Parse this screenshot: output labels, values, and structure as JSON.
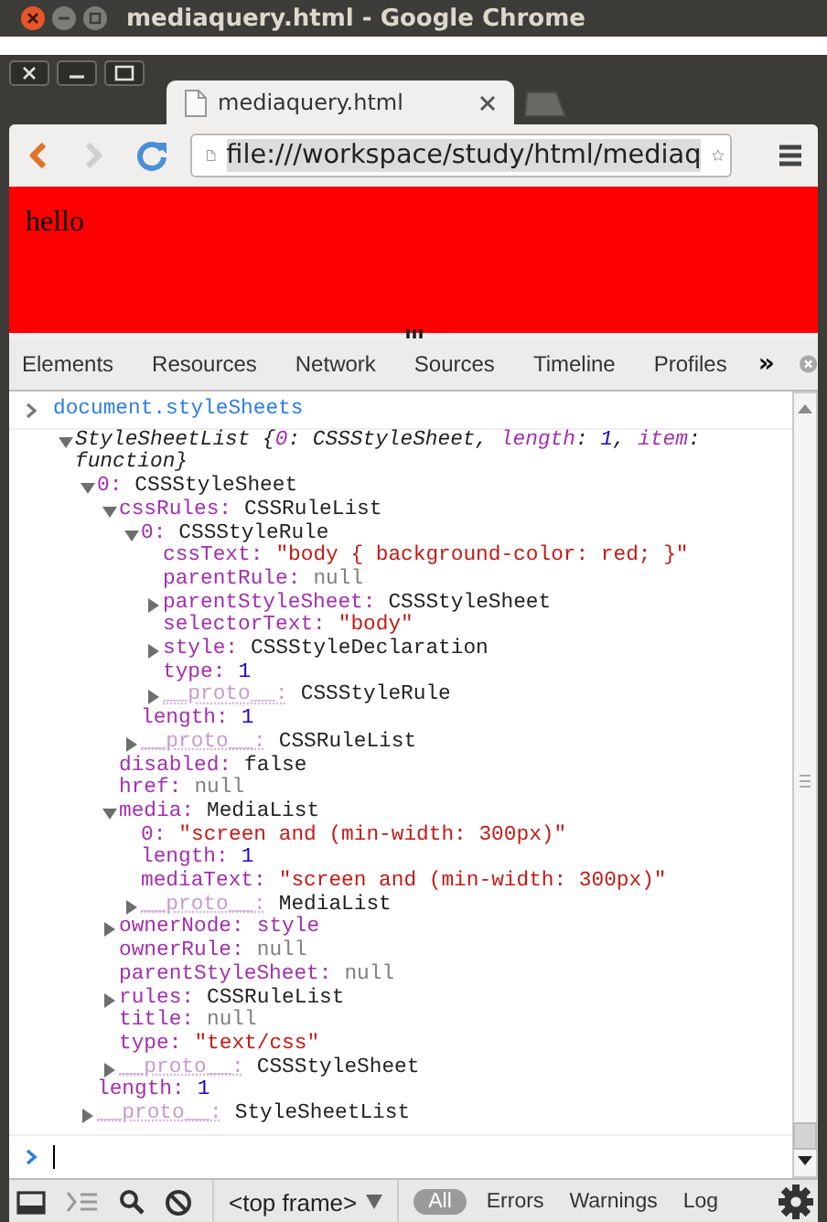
{
  "os_window": {
    "title": "mediaquery.html - Google Chrome"
  },
  "browser": {
    "tab": {
      "title": "mediaquery.html"
    },
    "address": {
      "url": "file:///workspace/study/html/mediaq",
      "selected": true
    },
    "back_disabled": false,
    "forward_disabled": true
  },
  "page": {
    "text": "hello"
  },
  "devtools": {
    "tabs": [
      "Elements",
      "Resources",
      "Network",
      "Sources",
      "Timeline",
      "Profiles"
    ],
    "overflow": "»",
    "console": {
      "command": "document.styleSheets",
      "result": {
        "summary": [
          {
            "text": "StyleSheetList {",
            "kind": "plain"
          },
          {
            "text": "0",
            "kind": "key"
          },
          {
            "text": ": CSSStyleSheet, ",
            "kind": "plain"
          },
          {
            "text": "length",
            "kind": "key"
          },
          {
            "text": ": ",
            "kind": "plain"
          },
          {
            "text": "1",
            "kind": "number"
          },
          {
            "text": ", ",
            "kind": "plain"
          },
          {
            "text": "item",
            "kind": "key"
          },
          {
            "text": ": function}",
            "kind": "plain"
          }
        ],
        "expanded": true,
        "children": [
          {
            "kind": "object",
            "key": "0:",
            "internal": false,
            "value": {
              "text": "CSSStyleSheet",
              "kind": "object"
            },
            "expanded": true,
            "children": [
              {
                "kind": "object",
                "key": "cssRules:",
                "internal": false,
                "value": {
                  "text": "CSSRuleList",
                  "kind": "object"
                },
                "expanded": true,
                "children": [
                  {
                    "kind": "object",
                    "key": "0:",
                    "internal": false,
                    "value": {
                      "text": "CSSStyleRule",
                      "kind": "object"
                    },
                    "expanded": true,
                    "children": [
                      {
                        "kind": "leaf",
                        "key": "cssText:",
                        "internal": false,
                        "value": {
                          "text": "\"body { background-color: red; }\"",
                          "kind": "string"
                        }
                      },
                      {
                        "kind": "leaf",
                        "key": "parentRule:",
                        "internal": false,
                        "value": {
                          "text": "null",
                          "kind": "null"
                        }
                      },
                      {
                        "kind": "object",
                        "key": "parentStyleSheet:",
                        "internal": false,
                        "value": {
                          "text": "CSSStyleSheet",
                          "kind": "object"
                        },
                        "expanded": false
                      },
                      {
                        "kind": "leaf",
                        "key": "selectorText:",
                        "internal": false,
                        "value": {
                          "text": "\"body\"",
                          "kind": "string"
                        }
                      },
                      {
                        "kind": "object",
                        "key": "style:",
                        "internal": false,
                        "value": {
                          "text": "CSSStyleDeclaration",
                          "kind": "object"
                        },
                        "expanded": false
                      },
                      {
                        "kind": "leaf",
                        "key": "type:",
                        "internal": false,
                        "value": {
                          "text": "1",
                          "kind": "number"
                        }
                      },
                      {
                        "kind": "object",
                        "key": "__proto__:",
                        "internal": true,
                        "value": {
                          "text": "CSSStyleRule",
                          "kind": "object"
                        },
                        "expanded": false
                      }
                    ]
                  },
                  {
                    "kind": "leaf",
                    "key": "length:",
                    "internal": false,
                    "value": {
                      "text": "1",
                      "kind": "number"
                    }
                  },
                  {
                    "kind": "object",
                    "key": "__proto__:",
                    "internal": true,
                    "value": {
                      "text": "CSSRuleList",
                      "kind": "object"
                    },
                    "expanded": false
                  }
                ]
              },
              {
                "kind": "leaf",
                "key": "disabled:",
                "internal": false,
                "value": {
                  "text": "false",
                  "kind": "object"
                }
              },
              {
                "kind": "leaf",
                "key": "href:",
                "internal": false,
                "value": {
                  "text": "null",
                  "kind": "null"
                }
              },
              {
                "kind": "object",
                "key": "media:",
                "internal": false,
                "value": {
                  "text": "MediaList",
                  "kind": "object"
                },
                "expanded": true,
                "children": [
                  {
                    "kind": "leaf",
                    "key": "0:",
                    "internal": false,
                    "value": {
                      "text": "\"screen and (min-width: 300px)\"",
                      "kind": "string"
                    }
                  },
                  {
                    "kind": "leaf",
                    "key": "length:",
                    "internal": false,
                    "value": {
                      "text": "1",
                      "kind": "number"
                    }
                  },
                  {
                    "kind": "leaf",
                    "key": "mediaText:",
                    "internal": false,
                    "value": {
                      "text": "\"screen and (min-width: 300px)\"",
                      "kind": "string"
                    }
                  },
                  {
                    "kind": "object",
                    "key": "__proto__:",
                    "internal": true,
                    "value": {
                      "text": "MediaList",
                      "kind": "object"
                    },
                    "expanded": false
                  }
                ]
              },
              {
                "kind": "object",
                "key": "ownerNode:",
                "internal": false,
                "value": {
                  "text": "style",
                  "kind": "node"
                },
                "expanded": false
              },
              {
                "kind": "leaf",
                "key": "ownerRule:",
                "internal": false,
                "value": {
                  "text": "null",
                  "kind": "null"
                }
              },
              {
                "kind": "leaf",
                "key": "parentStyleSheet:",
                "internal": false,
                "value": {
                  "text": "null",
                  "kind": "null"
                }
              },
              {
                "kind": "object",
                "key": "rules:",
                "internal": false,
                "value": {
                  "text": "CSSRuleList",
                  "kind": "object"
                },
                "expanded": false
              },
              {
                "kind": "leaf",
                "key": "title:",
                "internal": false,
                "value": {
                  "text": "null",
                  "kind": "null"
                }
              },
              {
                "kind": "leaf",
                "key": "type:",
                "internal": false,
                "value": {
                  "text": "\"text/css\"",
                  "kind": "string"
                }
              },
              {
                "kind": "object",
                "key": "__proto__:",
                "internal": true,
                "value": {
                  "text": "CSSStyleSheet",
                  "kind": "object"
                },
                "expanded": false
              }
            ]
          },
          {
            "kind": "leaf",
            "key": "length:",
            "internal": false,
            "value": {
              "text": "1",
              "kind": "number"
            }
          },
          {
            "kind": "object",
            "key": "__proto__:",
            "internal": true,
            "value": {
              "text": "StyleSheetList",
              "kind": "object"
            },
            "expanded": false
          }
        ]
      }
    },
    "status_bar": {
      "frame": "<top frame>",
      "filters": [
        {
          "label": "All",
          "selected": true
        },
        {
          "label": "Errors",
          "selected": false
        },
        {
          "label": "Warnings",
          "selected": false
        },
        {
          "label": "Log",
          "selected": false
        }
      ]
    }
  }
}
